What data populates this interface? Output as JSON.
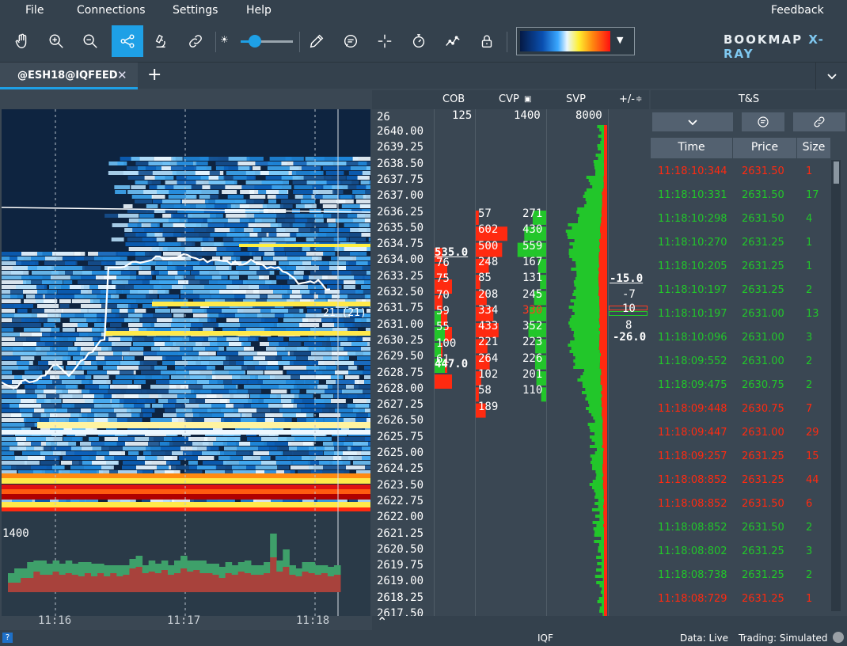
{
  "menu": {
    "file": "File",
    "connections": "Connections",
    "settings": "Settings",
    "help": "Help",
    "feedback": "Feedback"
  },
  "toolbar": {
    "tools": [
      "hand-icon",
      "zoom-in-icon",
      "zoom-out-icon",
      "share-nodes-icon",
      "microscope-icon",
      "link-icon",
      "brightness-icon",
      "pencil-icon",
      "chat-icon",
      "crosshair-icon",
      "stopwatch-icon",
      "chart-line-icon",
      "lock-icon"
    ],
    "active_tool": "share-nodes-icon",
    "brightness_level": 0.27,
    "logo": "BOOKMAP",
    "logo_suffix": "X-RAY"
  },
  "tabs": [
    {
      "label": "@ESH18@IQFEED",
      "active": true
    }
  ],
  "chart": {
    "volume_scale_label": "1400",
    "time_ticks": [
      "11:16",
      "11:17",
      "11:18"
    ],
    "last_trade_marker": "21 (21)",
    "volume_bars": {
      "sell": [
        12,
        12,
        18,
        18,
        26,
        22,
        22,
        26,
        22,
        24,
        22,
        20,
        24,
        20,
        24,
        20,
        24,
        20,
        22,
        30,
        32,
        24,
        26,
        24,
        28,
        22,
        24,
        30,
        26,
        28,
        24,
        24,
        22,
        18,
        24,
        22,
        26,
        24,
        22,
        22,
        24,
        44,
        26,
        32,
        22,
        20,
        26,
        24,
        22,
        24,
        20,
        22
      ],
      "buy": [
        12,
        18,
        12,
        20,
        14,
        18,
        14,
        14,
        14,
        16,
        14,
        18,
        14,
        16,
        12,
        14,
        10,
        14,
        12,
        12,
        14,
        10,
        14,
        12,
        12,
        12,
        16,
        16,
        14,
        12,
        16,
        12,
        14,
        14,
        14,
        12,
        12,
        16,
        12,
        12,
        14,
        30,
        14,
        22,
        12,
        10,
        12,
        14,
        12,
        10,
        12,
        12
      ]
    }
  },
  "columns": {
    "cob": "COB",
    "cvp": "CVP",
    "svp": "SVP",
    "plus_minus": "+/-",
    "ts": "T&S"
  },
  "price_ladder": {
    "top_label": "26",
    "cob_max": "125",
    "cvp_max": "1400",
    "svp_max": "8000",
    "prices": [
      "2640.00",
      "2639.25",
      "2638.50",
      "2637.75",
      "2637.00",
      "2636.25",
      "2635.50",
      "2634.75",
      "2634.00",
      "2633.25",
      "2632.50",
      "2631.75",
      "2631.00",
      "2630.25",
      "2629.50",
      "2628.75",
      "2628.00",
      "2627.25",
      "2626.50",
      "2625.75",
      "2625.00",
      "2624.25",
      "2623.50",
      "2622.75",
      "2622.00",
      "2621.25",
      "2620.50",
      "2619.75",
      "2619.00",
      "2618.25",
      "2617.50"
    ]
  },
  "cob": {
    "ask_total": "535.0",
    "bid_total": "447.0",
    "values": [
      "76",
      "75",
      "70",
      "59",
      "55",
      "100",
      "61"
    ]
  },
  "cvp": {
    "sell": [
      "57",
      "602",
      "500",
      "248",
      "85",
      "208",
      "334",
      "433",
      "221",
      "264",
      "102",
      "58",
      "189"
    ],
    "buy": [
      "271",
      "430",
      "559",
      "167",
      "131",
      "245",
      "330",
      "352",
      "223",
      "226",
      "201",
      "110"
    ]
  },
  "svp": {
    "sell_pct": [
      0.15,
      0.18,
      0.22,
      0.28,
      0.35,
      0.42,
      0.5,
      0.55,
      0.6,
      0.62,
      0.6,
      0.58,
      0.55,
      0.55,
      0.5,
      0.45,
      0.4,
      0.38,
      0.35,
      0.33,
      0.3,
      0.3,
      0.28,
      0.26,
      0.24,
      0.22,
      0.2,
      0.18,
      0.16,
      0.16,
      0.15
    ],
    "buy_pct": [
      0.1,
      0.14,
      0.2,
      0.28,
      0.38,
      0.55,
      0.65,
      0.6,
      0.55,
      0.5,
      0.55,
      0.58,
      0.62,
      0.58,
      0.5,
      0.42,
      0.34,
      0.28,
      0.24,
      0.22,
      0.2,
      0.2,
      0.2,
      0.18,
      0.16,
      0.14,
      0.12,
      0.12,
      0.1,
      0.1,
      0.1
    ]
  },
  "plus_minus": {
    "values": [
      "-15.0",
      "-7",
      "10",
      "8",
      "-26.0"
    ]
  },
  "ts": {
    "headers": [
      "Time",
      "Price",
      "Size"
    ],
    "rows": [
      {
        "time": "11:18:10:344",
        "price": "2631.50",
        "size": "1",
        "side": "sell"
      },
      {
        "time": "11:18:10:331",
        "price": "2631.50",
        "size": "17",
        "side": "buy"
      },
      {
        "time": "11:18:10:298",
        "price": "2631.50",
        "size": "4",
        "side": "buy"
      },
      {
        "time": "11:18:10:270",
        "price": "2631.25",
        "size": "1",
        "side": "buy"
      },
      {
        "time": "11:18:10:205",
        "price": "2631.25",
        "size": "1",
        "side": "buy"
      },
      {
        "time": "11:18:10:197",
        "price": "2631.25",
        "size": "2",
        "side": "buy"
      },
      {
        "time": "11:18:10:197",
        "price": "2631.00",
        "size": "13",
        "side": "buy"
      },
      {
        "time": "11:18:10:096",
        "price": "2631.00",
        "size": "3",
        "side": "buy"
      },
      {
        "time": "11:18:09:552",
        "price": "2631.00",
        "size": "2",
        "side": "buy"
      },
      {
        "time": "11:18:09:475",
        "price": "2630.75",
        "size": "2",
        "side": "buy"
      },
      {
        "time": "11:18:09:448",
        "price": "2630.75",
        "size": "7",
        "side": "sell"
      },
      {
        "time": "11:18:09:447",
        "price": "2631.00",
        "size": "29",
        "side": "sell"
      },
      {
        "time": "11:18:09:257",
        "price": "2631.25",
        "size": "15",
        "side": "sell"
      },
      {
        "time": "11:18:08:852",
        "price": "2631.25",
        "size": "44",
        "side": "sell"
      },
      {
        "time": "11:18:08:852",
        "price": "2631.50",
        "size": "6",
        "side": "sell"
      },
      {
        "time": "11:18:08:852",
        "price": "2631.50",
        "size": "2",
        "side": "buy"
      },
      {
        "time": "11:18:08:802",
        "price": "2631.25",
        "size": "3",
        "side": "buy"
      },
      {
        "time": "11:18:08:738",
        "price": "2631.25",
        "size": "2",
        "side": "buy"
      },
      {
        "time": "11:18:08:729",
        "price": "2631.25",
        "size": "1",
        "side": "sell"
      }
    ]
  },
  "status": {
    "feed": "IQF",
    "data": "Data: Live",
    "trading": "Trading: Simulated"
  },
  "colors": {
    "buy": "#22c62a",
    "sell": "#ff2a10",
    "accent": "#1ea0e6",
    "panel": "#3a4753"
  }
}
